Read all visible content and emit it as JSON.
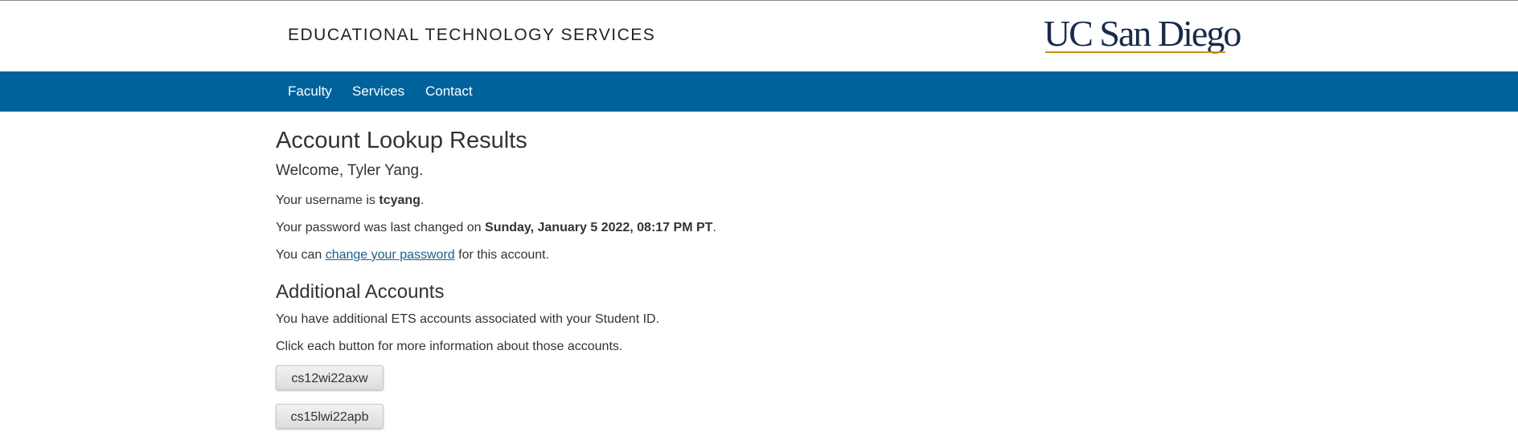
{
  "header": {
    "site_title": "EDUCATIONAL TECHNOLOGY SERVICES",
    "logo_text": "UC San Diego"
  },
  "nav": {
    "items": [
      {
        "label": "Faculty"
      },
      {
        "label": "Services"
      },
      {
        "label": "Contact"
      }
    ]
  },
  "main": {
    "title": "Account Lookup Results",
    "welcome": "Welcome, Tyler Yang.",
    "username_prefix": "Your username is ",
    "username": "tcyang",
    "username_suffix": ".",
    "password_prefix": "Your password was last changed on ",
    "password_date": "Sunday, January 5 2022, 08:17 PM PT",
    "password_suffix": ".",
    "change_prefix": "You can ",
    "change_link": "change your password",
    "change_suffix": " for this account."
  },
  "additional": {
    "title": "Additional Accounts",
    "line1": "You have additional ETS accounts associated with your Student ID.",
    "line2": "Click each button for more information about those accounts.",
    "accounts": [
      {
        "label": "cs12wi22axw"
      },
      {
        "label": "cs15lwi22apb"
      }
    ]
  },
  "colors": {
    "navbar": "#00629b",
    "logo_navy": "#182b49",
    "logo_gold": "#c69214",
    "link": "#1d5f8a"
  }
}
